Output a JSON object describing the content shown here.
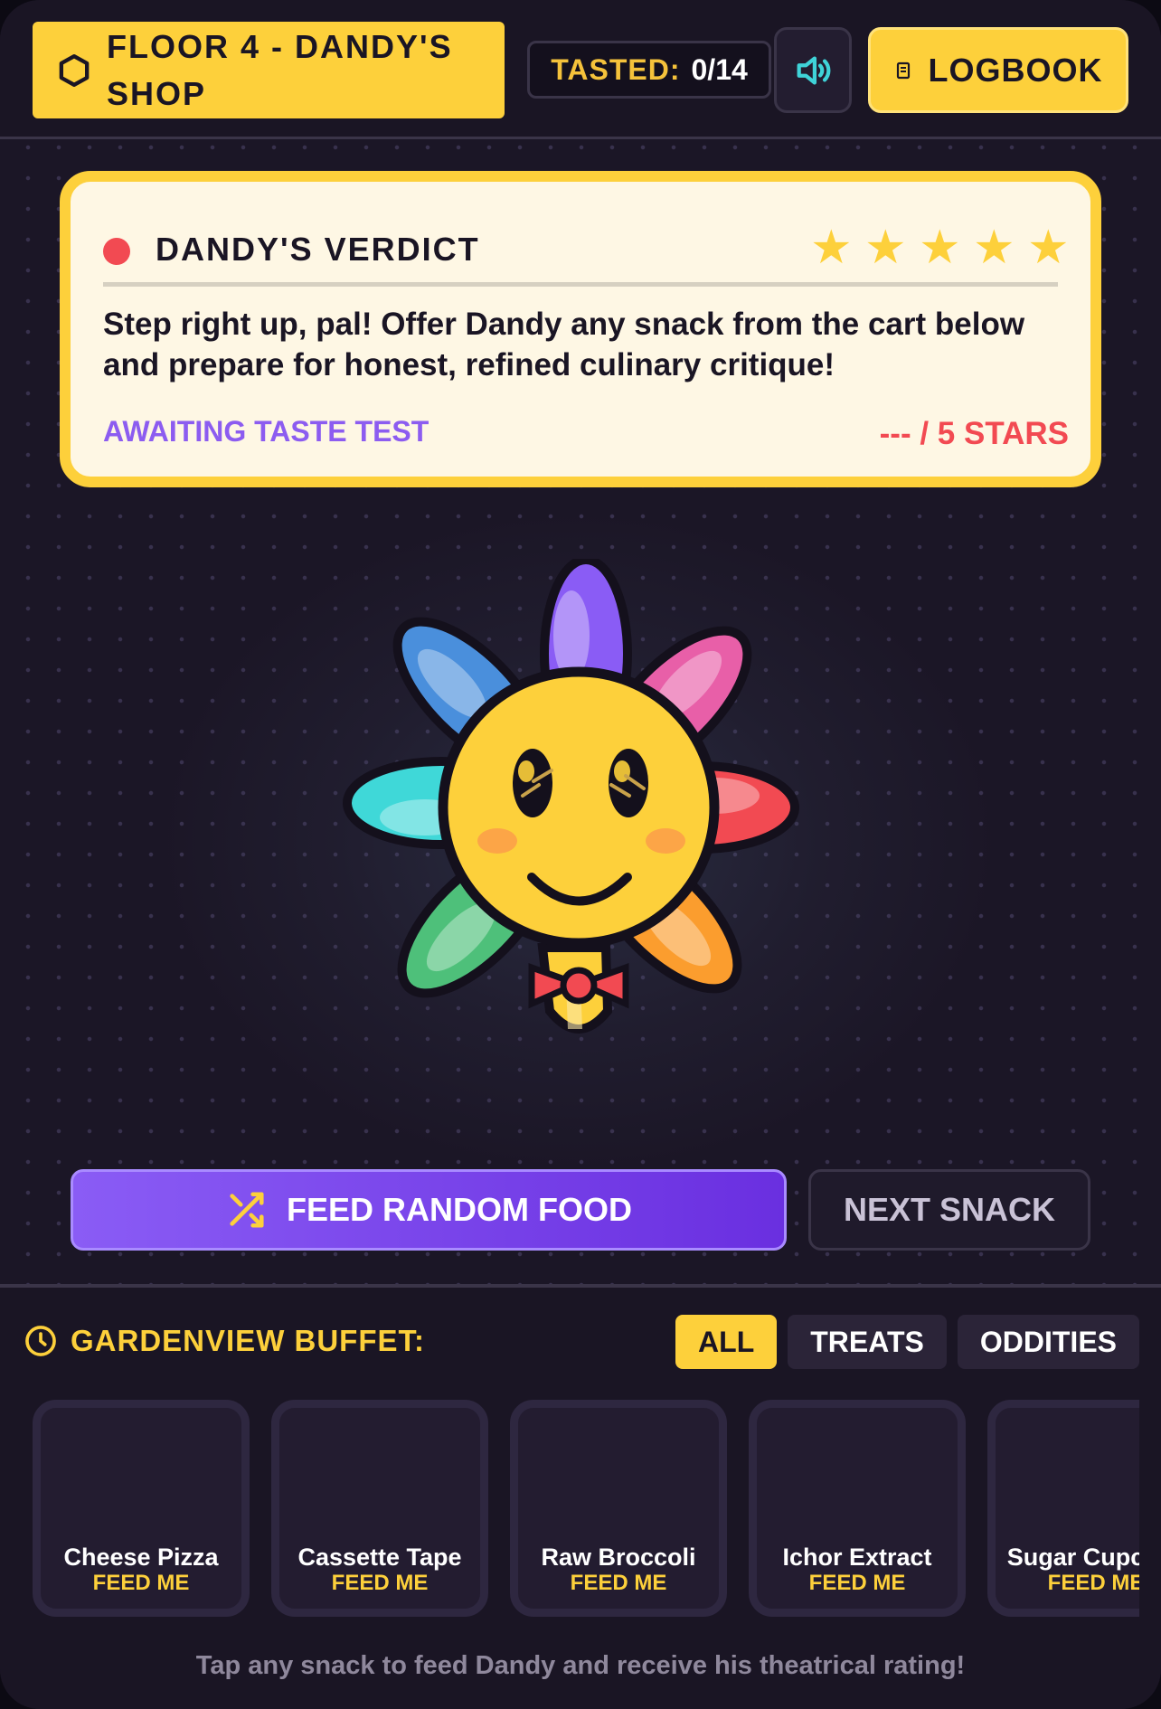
{
  "header": {
    "floor_label": "FLOOR 4 - DANDY'S SHOP",
    "tasted_label": "TASTED:",
    "tasted_value": "0/14",
    "logbook_label": "LOGBOOK"
  },
  "verdict": {
    "title": "DANDY'S VERDICT",
    "rating_stars": 5,
    "stars": [
      "★",
      "★",
      "★",
      "★",
      "★"
    ],
    "message": "Step right up, pal! Offer Dandy any snack from the cart below and prepare for honest, refined culinary critique!",
    "status": "AWAITING TASTE TEST",
    "score": "--- / 5 STARS"
  },
  "actions": {
    "feed_random_label": "FEED RANDOM FOOD",
    "next_snack_label": "NEXT SNACK"
  },
  "buffet": {
    "title": "GARDENVIEW BUFFET:",
    "filters": [
      {
        "label": "ALL",
        "active": true
      },
      {
        "label": "TREATS",
        "active": false
      },
      {
        "label": "ODDITIES",
        "active": false
      }
    ],
    "items": [
      {
        "name": "Cheese Pizza",
        "cta": "FEED ME"
      },
      {
        "name": "Cassette Tape",
        "cta": "FEED ME"
      },
      {
        "name": "Raw Broccoli",
        "cta": "FEED ME"
      },
      {
        "name": "Ichor Extract",
        "cta": "FEED ME"
      },
      {
        "name": "Sugar Cupcake",
        "cta": "FEED ME"
      }
    ],
    "hint": "Tap any snack to feed Dandy and receive his theatrical rating!"
  },
  "colors": {
    "accent_yellow": "#fdd03b",
    "accent_purple": "#8c5cf0",
    "alert_red": "#f24a52",
    "background": "#1b1626"
  },
  "icons": {
    "floor": "hexagon-icon",
    "sound": "speaker-icon",
    "logbook": "book-icon",
    "feed_random": "shuffle-icon",
    "buffet": "clock-icon"
  }
}
